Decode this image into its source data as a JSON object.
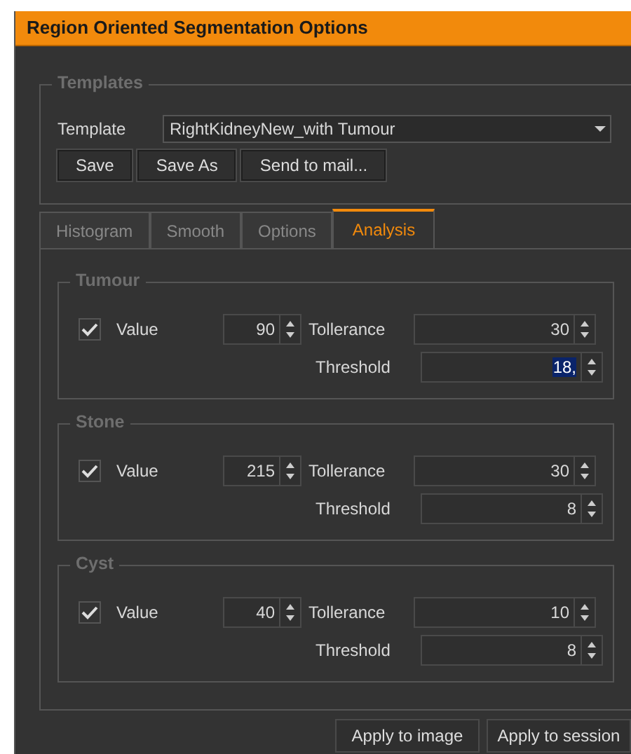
{
  "window": {
    "title": "Region Oriented Segmentation Options"
  },
  "templates": {
    "legend": "Templates",
    "label": "Template",
    "value": "RightKidneyNew_with Tumour",
    "buttons": [
      "Save",
      "Save As",
      "Send to mail..."
    ]
  },
  "tabs": [
    {
      "label": "Histogram",
      "selected": false
    },
    {
      "label": "Smooth",
      "selected": false
    },
    {
      "label": "Options",
      "selected": false
    },
    {
      "label": "Analysis",
      "selected": true
    }
  ],
  "groups": [
    {
      "legend": "Tumour",
      "checked": true,
      "value_label": "Value",
      "value": "90",
      "tolerance_label": "Tollerance",
      "tolerance": "30",
      "threshold_label": "Threshold",
      "threshold": "18,",
      "threshold_highlighted": true
    },
    {
      "legend": "Stone",
      "checked": true,
      "value_label": "Value",
      "value": "215",
      "tolerance_label": "Tollerance",
      "tolerance": "30",
      "threshold_label": "Threshold",
      "threshold": "8",
      "threshold_highlighted": false
    },
    {
      "legend": "Cyst",
      "checked": true,
      "value_label": "Value",
      "value": "40",
      "tolerance_label": "Tollerance",
      "tolerance": "10",
      "threshold_label": "Threshold",
      "threshold": "8",
      "threshold_highlighted": false
    }
  ],
  "footer_buttons": [
    "Apply to image",
    "Apply to session"
  ]
}
